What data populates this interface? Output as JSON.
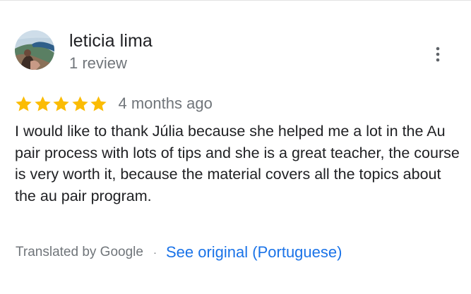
{
  "review": {
    "author_name": "leticia lima",
    "author_meta": "1 review",
    "rating": 5,
    "rating_max": 5,
    "date": "4 months ago",
    "text": "I would like to thank Júlia because she helped me a lot in the Au pair process with lots of tips and she is a great teacher, the course is very worth it, because the material covers all the topics about the au pair program.",
    "translated_label": "Translated by Google",
    "separator": "·",
    "see_original_label": "See original (Portuguese)"
  },
  "icons": {
    "avatar": "profile-photo",
    "more": "more-vert-icon",
    "star": "star-icon"
  },
  "colors": {
    "star": "#fbbc04",
    "link": "#1a73e8",
    "secondary_text": "#70757a",
    "primary_text": "#202124"
  }
}
